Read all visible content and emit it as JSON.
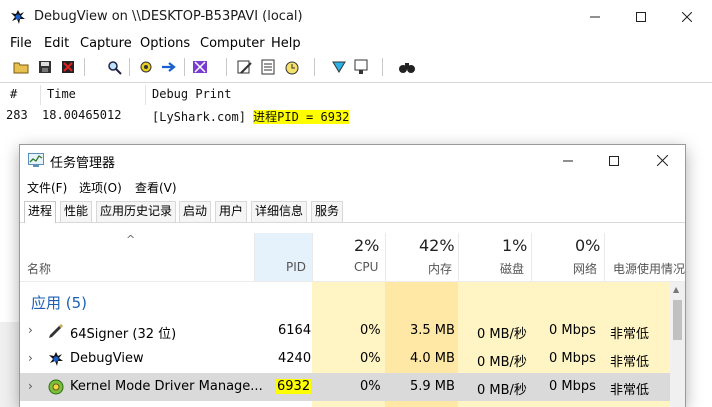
{
  "debugview": {
    "title": "DebugView on \\\\DESKTOP-B53PAVI (local)",
    "menu": [
      "File",
      "Edit",
      "Capture",
      "Options",
      "Computer",
      "Help"
    ],
    "columns": {
      "num": "#",
      "time": "Time",
      "print": "Debug Print"
    },
    "rows": [
      {
        "num": "283",
        "time": "18.00465012",
        "prefix": "[LyShark.com] ",
        "highlight": "进程PID = 6932"
      }
    ]
  },
  "taskmanager": {
    "title": "任务管理器",
    "menu": [
      "文件(F)",
      "选项(O)",
      "查看(V)"
    ],
    "tabs": [
      "进程",
      "性能",
      "应用历史记录",
      "启动",
      "用户",
      "详细信息",
      "服务"
    ],
    "active_tab": "进程",
    "columns": {
      "name": "名称",
      "pid": "PID",
      "cpu_pct": "2%",
      "cpu": "CPU",
      "mem_pct": "42%",
      "mem": "内存",
      "disk_pct": "1%",
      "disk": "磁盘",
      "net_pct": "0%",
      "net": "网络",
      "power": "电源使用情况"
    },
    "group_label": "应用 (5)",
    "processes": [
      {
        "name": "64Signer (32 位)",
        "pid": "6164",
        "cpu": "0%",
        "mem": "3.5 MB",
        "disk": "0 MB/秒",
        "net": "0 Mbps",
        "power": "非常低",
        "icon": "pen-icon",
        "selected": false
      },
      {
        "name": "DebugView",
        "pid": "4240",
        "cpu": "0%",
        "mem": "4.0 MB",
        "disk": "0 MB/秒",
        "net": "0 Mbps",
        "power": "非常低",
        "icon": "debugview-icon",
        "selected": false
      },
      {
        "name": "Kernel Mode Driver Manage...",
        "pid": "6932",
        "cpu": "0%",
        "mem": "5.9 MB",
        "disk": "0 MB/秒",
        "net": "0 Mbps",
        "power": "非常低",
        "icon": "driver-gear-icon",
        "selected": true
      }
    ]
  },
  "colors": {
    "highlight": "#ffff00",
    "heat_light": "#fff4c4",
    "heat_mem": "#ffe8a6",
    "pid_column": "#e5f1fb",
    "group_label": "#1c5fb5",
    "selected_row": "#dadada"
  }
}
